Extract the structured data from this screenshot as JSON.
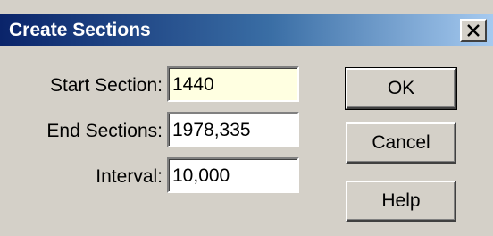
{
  "dialog": {
    "title": "Create Sections",
    "close_icon": "close-icon"
  },
  "fields": {
    "start_section": {
      "label": "Start Section:",
      "value": "1440"
    },
    "end_sections": {
      "label": "End Sections:",
      "value": "1978,335"
    },
    "interval": {
      "label": "Interval:",
      "value": "10,000"
    }
  },
  "buttons": {
    "ok": "OK",
    "cancel": "Cancel",
    "help": "Help"
  },
  "colors": {
    "titlebar_start": "#0a246a",
    "titlebar_end": "#a6caf0",
    "active_field": "#ffffe1",
    "dialog_bg": "#d4d0c8"
  }
}
